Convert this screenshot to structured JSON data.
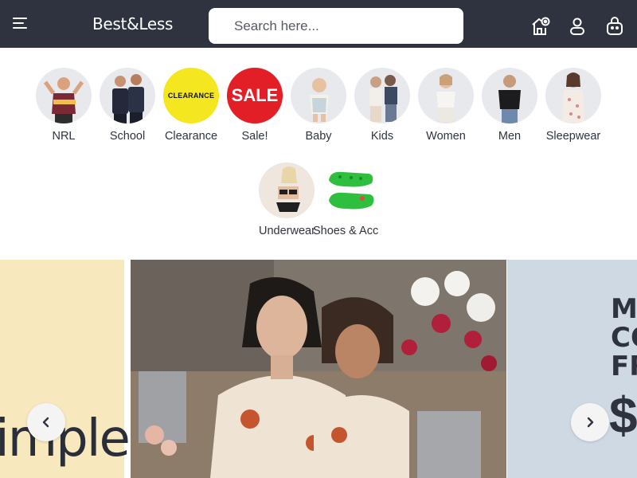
{
  "header": {
    "logo": "Best&Less",
    "search_placeholder": "Search here..."
  },
  "categories": [
    {
      "label": "NRL",
      "icon": "nrl-jersey-kid-photo"
    },
    {
      "label": "School",
      "icon": "school-uniform-photo"
    },
    {
      "label": "Clearance",
      "badge": "CLEARANCE",
      "bg": "#f5e71f"
    },
    {
      "label": "Sale!",
      "badge": "SALE",
      "bg": "#e21e26"
    },
    {
      "label": "Baby",
      "icon": "baby-photo"
    },
    {
      "label": "Kids",
      "icon": "kids-photo"
    },
    {
      "label": "Women",
      "icon": "women-photo"
    },
    {
      "label": "Men",
      "icon": "men-photo"
    },
    {
      "label": "Sleepwear",
      "icon": "sleepwear-photo"
    },
    {
      "label": "Underwear",
      "icon": "underwear-photo"
    },
    {
      "label": "Shoes & Acc",
      "icon": "green-clogs-photo"
    }
  ],
  "hero": {
    "left_text": "imple",
    "right_text_lines": [
      "MA",
      "CO",
      "FR"
    ],
    "right_price": "$"
  },
  "colors": {
    "header_bg": "#2f3340",
    "clearance": "#f5e71f",
    "sale": "#e21e26",
    "hero_left_bg": "#f7e8bd",
    "hero_right_bg": "#cfd9e4"
  }
}
